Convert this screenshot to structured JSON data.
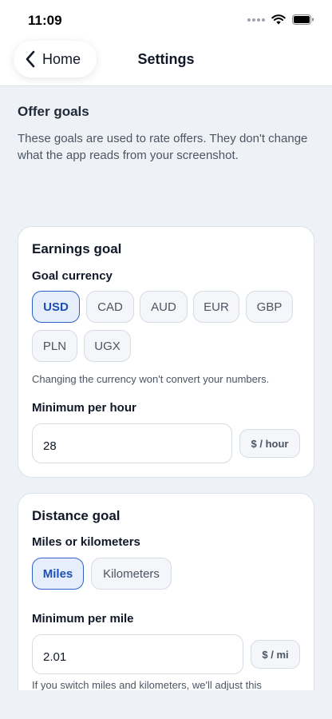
{
  "status_bar": {
    "time": "11:09"
  },
  "nav": {
    "back_label": "Home",
    "title": "Settings"
  },
  "intro": {
    "title": "Offer goals",
    "description": "These goals are used to rate offers. They don't change what the app reads from your screenshot."
  },
  "earnings": {
    "title": "Earnings goal",
    "currency_label": "Goal currency",
    "currencies": [
      "USD",
      "CAD",
      "AUD",
      "EUR",
      "GBP",
      "PLN",
      "UGX"
    ],
    "selected_currency": "USD",
    "currency_hint": "Changing the currency won't convert your numbers.",
    "min_label": "Minimum per hour",
    "min_value": "28",
    "min_unit": "$ / hour"
  },
  "distance": {
    "title": "Distance goal",
    "unit_label": "Miles or kilometers",
    "units": [
      "Miles",
      "Kilometers"
    ],
    "selected_unit": "Miles",
    "min_label": "Minimum per mile",
    "min_value": "2.01",
    "min_unit": "$ / mi",
    "hint": "If you switch miles and kilometers, we'll adjust this"
  },
  "colors": {
    "accent": "#2f5fc8",
    "background": "#eef2f6",
    "card": "#ffffff"
  },
  "icons": [
    "signal-dots-icon",
    "wifi-icon",
    "battery-icon",
    "chevron-left-icon"
  ]
}
